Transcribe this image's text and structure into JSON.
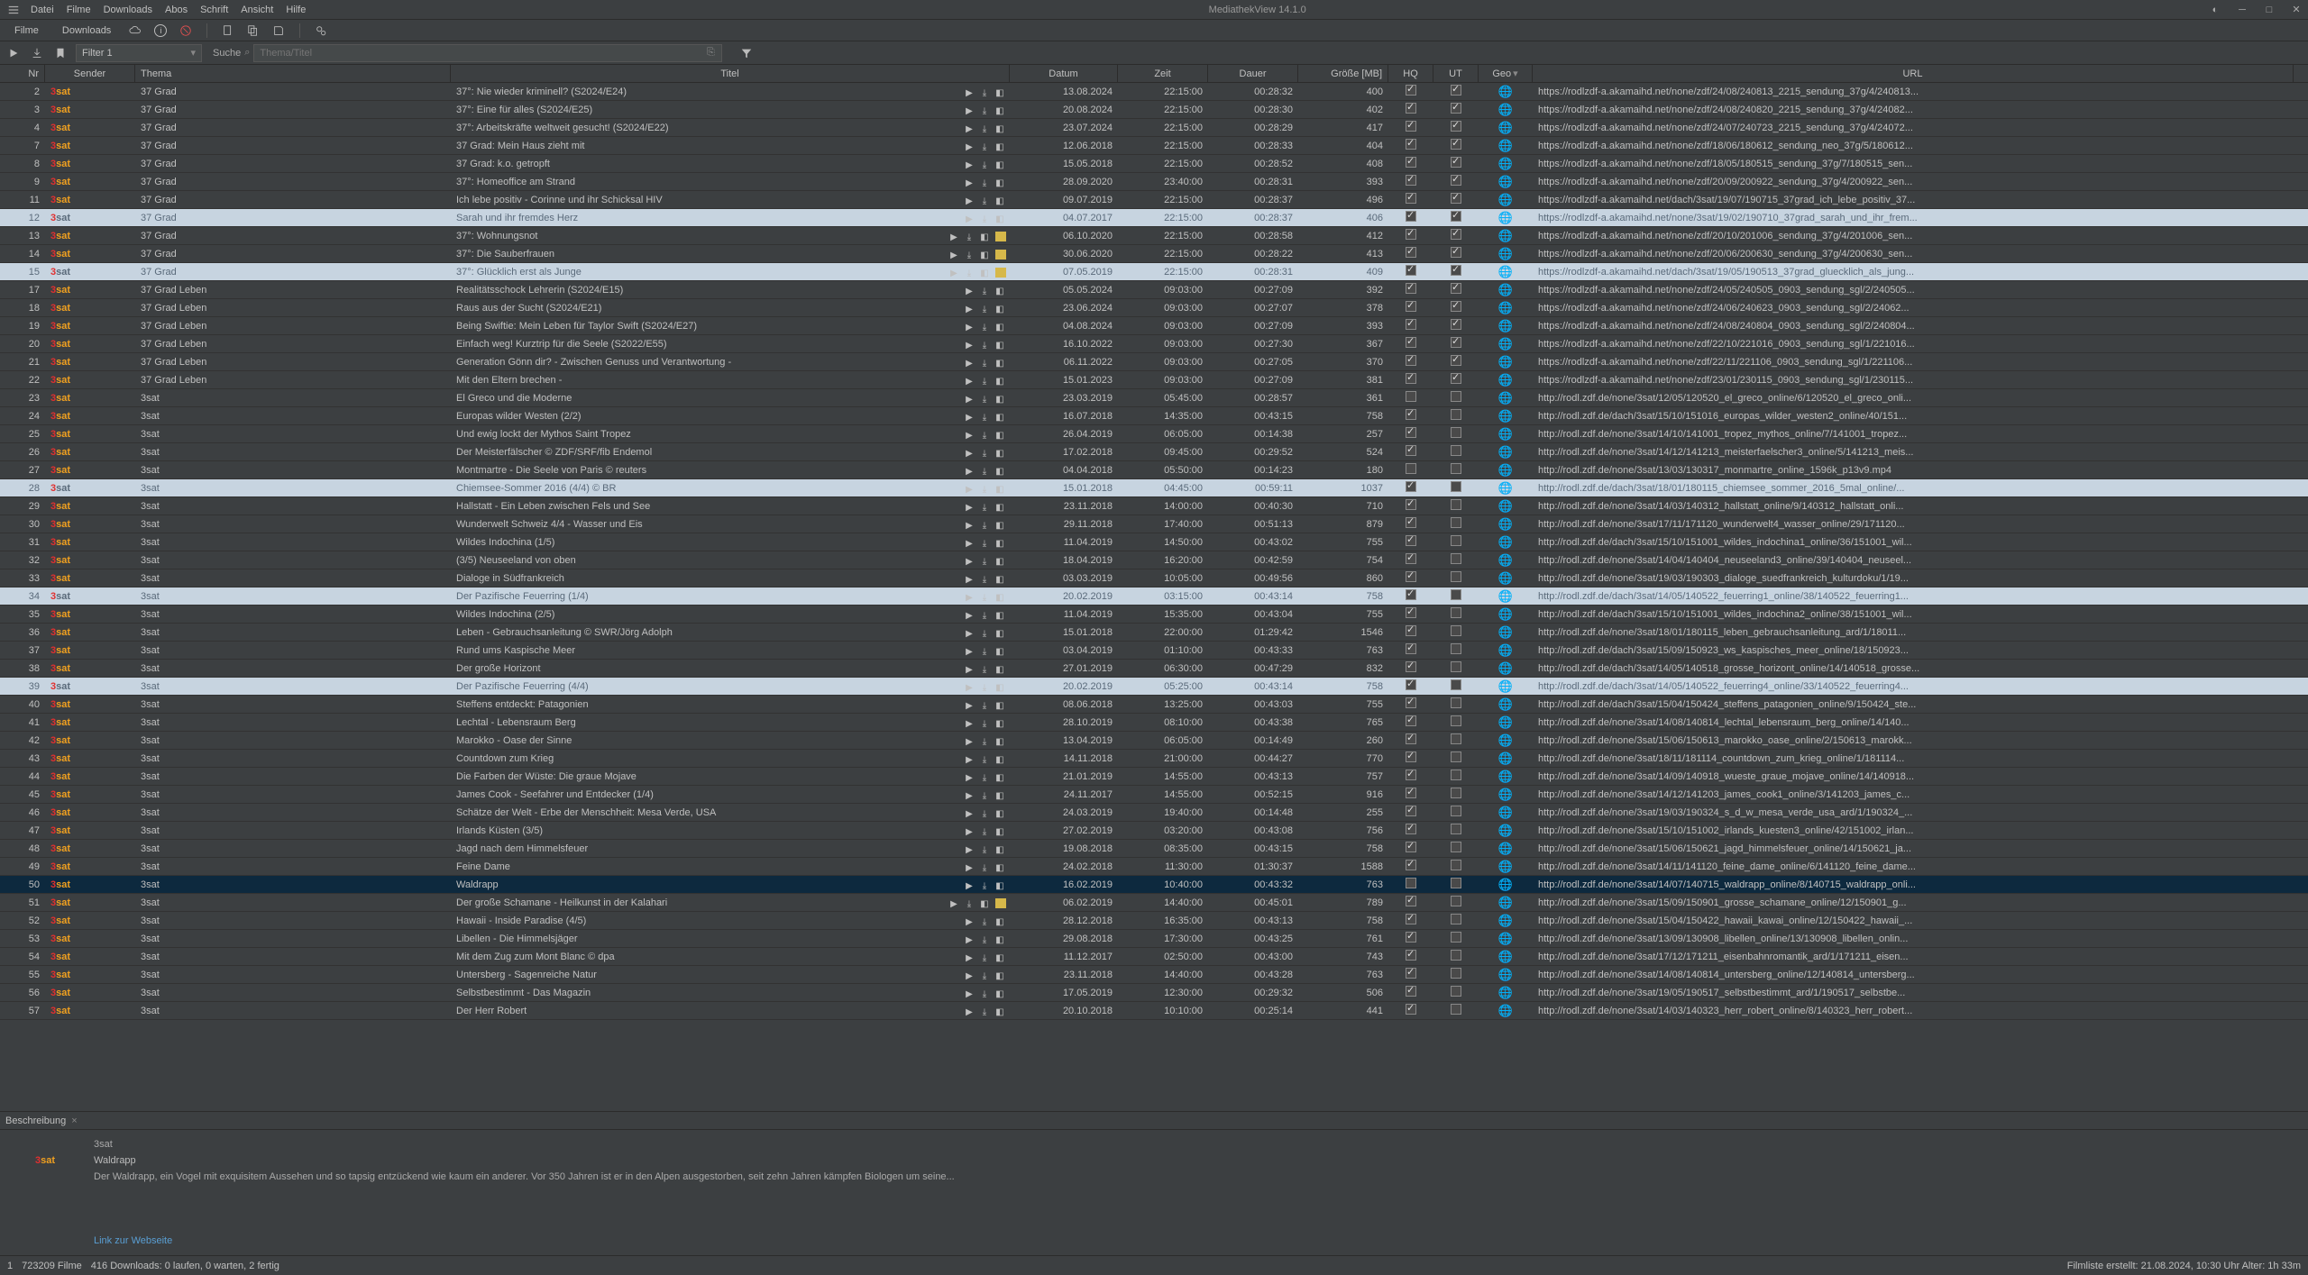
{
  "app": {
    "title": "MediathekView 14.1.0"
  },
  "menu": [
    "Datei",
    "Filme",
    "Downloads",
    "Abos",
    "Schrift",
    "Ansicht",
    "Hilfe"
  ],
  "tabs": {
    "films": "Filme",
    "downloads": "Downloads"
  },
  "filter": {
    "label": "Filter 1"
  },
  "search": {
    "label": "Suche",
    "placeholder": "Thema/Titel"
  },
  "columns": {
    "nr": "Nr",
    "sender": "Sender",
    "thema": "Thema",
    "titel": "Titel",
    "datum": "Datum",
    "zeit": "Zeit",
    "dauer": "Dauer",
    "size": "Größe [MB]",
    "hq": "HQ",
    "ut": "UT",
    "geo": "Geo",
    "url": "URL"
  },
  "rows": [
    {
      "nr": 2,
      "thema": "37 Grad",
      "titel": "37°: Nie wieder kriminell? (S2024/E24)",
      "datum": "13.08.2024",
      "zeit": "22:15:00",
      "dauer": "00:28:32",
      "size": 400,
      "hq": true,
      "ut": true,
      "url": "https://rodlzdf-a.akamaihd.net/none/zdf/24/08/240813_2215_sendung_37g/4/240813..."
    },
    {
      "nr": 3,
      "thema": "37 Grad",
      "titel": "37°: Eine für alles (S2024/E25)",
      "datum": "20.08.2024",
      "zeit": "22:15:00",
      "dauer": "00:28:30",
      "size": 402,
      "hq": true,
      "ut": true,
      "url": "https://rodlzdf-a.akamaihd.net/none/zdf/24/08/240820_2215_sendung_37g/4/24082..."
    },
    {
      "nr": 4,
      "thema": "37 Grad",
      "titel": "37°: Arbeitskräfte weltweit gesucht! (S2024/E22)",
      "datum": "23.07.2024",
      "zeit": "22:15:00",
      "dauer": "00:28:29",
      "size": 417,
      "hq": true,
      "ut": true,
      "url": "https://rodlzdf-a.akamaihd.net/none/zdf/24/07/240723_2215_sendung_37g/4/24072..."
    },
    {
      "nr": 7,
      "thema": "37 Grad",
      "titel": "37 Grad: Mein Haus zieht mit",
      "datum": "12.06.2018",
      "zeit": "22:15:00",
      "dauer": "00:28:33",
      "size": 404,
      "hq": true,
      "ut": true,
      "url": "https://rodlzdf-a.akamaihd.net/none/zdf/18/06/180612_sendung_neo_37g/5/180612..."
    },
    {
      "nr": 8,
      "thema": "37 Grad",
      "titel": "37 Grad: k.o. getropft",
      "datum": "15.05.2018",
      "zeit": "22:15:00",
      "dauer": "00:28:52",
      "size": 408,
      "hq": true,
      "ut": true,
      "url": "https://rodlzdf-a.akamaihd.net/none/zdf/18/05/180515_sendung_37g/7/180515_sen..."
    },
    {
      "nr": 9,
      "thema": "37 Grad",
      "titel": "37°: Homeoffice am Strand",
      "datum": "28.09.2020",
      "zeit": "23:40:00",
      "dauer": "00:28:31",
      "size": 393,
      "hq": true,
      "ut": true,
      "url": "https://rodlzdf-a.akamaihd.net/none/zdf/20/09/200922_sendung_37g/4/200922_sen..."
    },
    {
      "nr": 11,
      "thema": "37 Grad",
      "titel": "Ich lebe positiv - Corinne und ihr Schicksal HIV",
      "datum": "09.07.2019",
      "zeit": "22:15:00",
      "dauer": "00:28:37",
      "size": 496,
      "hq": true,
      "ut": true,
      "url": "https://rodlzdf-a.akamaihd.net/dach/3sat/19/07/190715_37grad_ich_lebe_positiv_37..."
    },
    {
      "nr": 12,
      "thema": "37 Grad",
      "titel": "Sarah und ihr fremdes Herz",
      "datum": "04.07.2017",
      "zeit": "22:15:00",
      "dauer": "00:28:37",
      "size": 406,
      "hq": true,
      "ut": true,
      "url": "https://rodlzdf-a.akamaihd.net/none/3sat/19/02/190710_37grad_sarah_und_ihr_frem...",
      "light": true
    },
    {
      "nr": 13,
      "thema": "37 Grad",
      "titel": "37°: Wohnungsnot",
      "datum": "06.10.2020",
      "zeit": "22:15:00",
      "dauer": "00:28:58",
      "size": 412,
      "hq": true,
      "ut": true,
      "url": "https://rodlzdf-a.akamaihd.net/none/zdf/20/10/201006_sendung_37g/4/201006_sen..."
    },
    {
      "nr": 14,
      "thema": "37 Grad",
      "titel": "37°: Die Sauberfrauen",
      "datum": "30.06.2020",
      "zeit": "22:15:00",
      "dauer": "00:28:22",
      "size": 413,
      "hq": true,
      "ut": true,
      "url": "https://rodlzdf-a.akamaihd.net/none/zdf/20/06/200630_sendung_37g/4/200630_sen..."
    },
    {
      "nr": 15,
      "thema": "37 Grad",
      "titel": "37°: Glücklich erst als Junge",
      "datum": "07.05.2019",
      "zeit": "22:15:00",
      "dauer": "00:28:31",
      "size": 409,
      "hq": true,
      "ut": true,
      "url": "https://rodlzdf-a.akamaihd.net/dach/3sat/19/05/190513_37grad_gluecklich_als_jung...",
      "light": true
    },
    {
      "nr": 17,
      "thema": "37 Grad Leben",
      "titel": "Realitätsschock Lehrerin (S2024/E15)",
      "datum": "05.05.2024",
      "zeit": "09:03:00",
      "dauer": "00:27:09",
      "size": 392,
      "hq": true,
      "ut": true,
      "url": "https://rodlzdf-a.akamaihd.net/none/zdf/24/05/240505_0903_sendung_sgl/2/240505..."
    },
    {
      "nr": 18,
      "thema": "37 Grad Leben",
      "titel": "Raus aus der Sucht (S2024/E21)",
      "datum": "23.06.2024",
      "zeit": "09:03:00",
      "dauer": "00:27:07",
      "size": 378,
      "hq": true,
      "ut": true,
      "url": "https://rodlzdf-a.akamaihd.net/none/zdf/24/06/240623_0903_sendung_sgl/2/24062..."
    },
    {
      "nr": 19,
      "thema": "37 Grad Leben",
      "titel": "Being Swiftie: Mein Leben für Taylor Swift (S2024/E27)",
      "datum": "04.08.2024",
      "zeit": "09:03:00",
      "dauer": "00:27:09",
      "size": 393,
      "hq": true,
      "ut": true,
      "url": "https://rodlzdf-a.akamaihd.net/none/zdf/24/08/240804_0903_sendung_sgl/2/240804..."
    },
    {
      "nr": 20,
      "thema": "37 Grad Leben",
      "titel": "Einfach weg! Kurztrip für die Seele (S2022/E55)",
      "datum": "16.10.2022",
      "zeit": "09:03:00",
      "dauer": "00:27:30",
      "size": 367,
      "hq": true,
      "ut": true,
      "url": "https://rodlzdf-a.akamaihd.net/none/zdf/22/10/221016_0903_sendung_sgl/1/221016..."
    },
    {
      "nr": 21,
      "thema": "37 Grad Leben",
      "titel": "Generation Gönn dir? - Zwischen Genuss und Verantwortung -",
      "datum": "06.11.2022",
      "zeit": "09:03:00",
      "dauer": "00:27:05",
      "size": 370,
      "hq": true,
      "ut": true,
      "url": "https://rodlzdf-a.akamaihd.net/none/zdf/22/11/221106_0903_sendung_sgl/1/221106..."
    },
    {
      "nr": 22,
      "thema": "37 Grad Leben",
      "titel": "Mit den Eltern brechen -",
      "datum": "15.01.2023",
      "zeit": "09:03:00",
      "dauer": "00:27:09",
      "size": 381,
      "hq": true,
      "ut": true,
      "url": "https://rodlzdf-a.akamaihd.net/none/zdf/23/01/230115_0903_sendung_sgl/1/230115..."
    },
    {
      "nr": 23,
      "thema": "3sat",
      "titel": "El Greco und die Moderne",
      "datum": "23.03.2019",
      "zeit": "05:45:00",
      "dauer": "00:28:57",
      "size": 361,
      "hq": false,
      "ut": false,
      "url": "http://rodl.zdf.de/none/3sat/12/05/120520_el_greco_online/6/120520_el_greco_onli..."
    },
    {
      "nr": 24,
      "thema": "3sat",
      "titel": "Europas wilder Westen (2/2)",
      "datum": "16.07.2018",
      "zeit": "14:35:00",
      "dauer": "00:43:15",
      "size": 758,
      "hq": true,
      "ut": false,
      "url": "http://rodl.zdf.de/dach/3sat/15/10/151016_europas_wilder_westen2_online/40/151..."
    },
    {
      "nr": 25,
      "thema": "3sat",
      "titel": "Und ewig lockt der Mythos Saint Tropez",
      "datum": "26.04.2019",
      "zeit": "06:05:00",
      "dauer": "00:14:38",
      "size": 257,
      "hq": true,
      "ut": false,
      "url": "http://rodl.zdf.de/none/3sat/14/10/141001_tropez_mythos_online/7/141001_tropez..."
    },
    {
      "nr": 26,
      "thema": "3sat",
      "titel": "Der Meisterfälscher © ZDF/SRF/fib Endemol",
      "datum": "17.02.2018",
      "zeit": "09:45:00",
      "dauer": "00:29:52",
      "size": 524,
      "hq": true,
      "ut": false,
      "url": "http://rodl.zdf.de/none/3sat/14/12/141213_meisterfaelscher3_online/5/141213_meis..."
    },
    {
      "nr": 27,
      "thema": "3sat",
      "titel": "Montmartre - Die Seele von Paris © reuters",
      "datum": "04.04.2018",
      "zeit": "05:50:00",
      "dauer": "00:14:23",
      "size": 180,
      "hq": false,
      "ut": false,
      "url": "http://rodl.zdf.de/none/3sat/13/03/130317_monmartre_online_1596k_p13v9.mp4"
    },
    {
      "nr": 28,
      "thema": "3sat",
      "titel": "Chiemsee-Sommer 2016 (4/4) © BR",
      "datum": "15.01.2018",
      "zeit": "04:45:00",
      "dauer": "00:59:11",
      "size": 1037,
      "hq": true,
      "ut": false,
      "url": "http://rodl.zdf.de/dach/3sat/18/01/180115_chiemsee_sommer_2016_5mal_online/...",
      "light": true
    },
    {
      "nr": 29,
      "thema": "3sat",
      "titel": "Hallstatt - Ein Leben zwischen Fels und See",
      "datum": "23.11.2018",
      "zeit": "14:00:00",
      "dauer": "00:40:30",
      "size": 710,
      "hq": true,
      "ut": false,
      "url": "http://rodl.zdf.de/none/3sat/14/03/140312_hallstatt_online/9/140312_hallstatt_onli..."
    },
    {
      "nr": 30,
      "thema": "3sat",
      "titel": "Wunderwelt Schweiz 4/4 - Wasser und Eis",
      "datum": "29.11.2018",
      "zeit": "17:40:00",
      "dauer": "00:51:13",
      "size": 879,
      "hq": true,
      "ut": false,
      "url": "http://rodl.zdf.de/none/3sat/17/11/171120_wunderwelt4_wasser_online/29/171120..."
    },
    {
      "nr": 31,
      "thema": "3sat",
      "titel": "Wildes Indochina (1/5)",
      "datum": "11.04.2019",
      "zeit": "14:50:00",
      "dauer": "00:43:02",
      "size": 755,
      "hq": true,
      "ut": false,
      "url": "http://rodl.zdf.de/dach/3sat/15/10/151001_wildes_indochina1_online/36/151001_wil..."
    },
    {
      "nr": 32,
      "thema": "3sat",
      "titel": "(3/5) Neuseeland von oben",
      "datum": "18.04.2019",
      "zeit": "16:20:00",
      "dauer": "00:42:59",
      "size": 754,
      "hq": true,
      "ut": false,
      "url": "http://rodl.zdf.de/none/3sat/14/04/140404_neuseeland3_online/39/140404_neuseel..."
    },
    {
      "nr": 33,
      "thema": "3sat",
      "titel": "Dialoge in Südfrankreich",
      "datum": "03.03.2019",
      "zeit": "10:05:00",
      "dauer": "00:49:56",
      "size": 860,
      "hq": true,
      "ut": false,
      "url": "http://rodl.zdf.de/none/3sat/19/03/190303_dialoge_suedfrankreich_kulturdoku/1/19..."
    },
    {
      "nr": 34,
      "thema": "3sat",
      "titel": "Der Pazifische Feuerring (1/4)",
      "datum": "20.02.2019",
      "zeit": "03:15:00",
      "dauer": "00:43:14",
      "size": 758,
      "hq": true,
      "ut": false,
      "url": "http://rodl.zdf.de/dach/3sat/14/05/140522_feuerring1_online/38/140522_feuerring1...",
      "light": true
    },
    {
      "nr": 35,
      "thema": "3sat",
      "titel": "Wildes Indochina (2/5)",
      "datum": "11.04.2019",
      "zeit": "15:35:00",
      "dauer": "00:43:04",
      "size": 755,
      "hq": true,
      "ut": false,
      "url": "http://rodl.zdf.de/dach/3sat/15/10/151001_wildes_indochina2_online/38/151001_wil..."
    },
    {
      "nr": 36,
      "thema": "3sat",
      "titel": "Leben - Gebrauchsanleitung © SWR/Jörg Adolph",
      "datum": "15.01.2018",
      "zeit": "22:00:00",
      "dauer": "01:29:42",
      "size": 1546,
      "hq": true,
      "ut": false,
      "url": "http://rodl.zdf.de/none/3sat/18/01/180115_leben_gebrauchsanleitung_ard/1/18011..."
    },
    {
      "nr": 37,
      "thema": "3sat",
      "titel": "Rund ums Kaspische Meer",
      "datum": "03.04.2019",
      "zeit": "01:10:00",
      "dauer": "00:43:33",
      "size": 763,
      "hq": true,
      "ut": false,
      "url": "http://rodl.zdf.de/dach/3sat/15/09/150923_ws_kaspisches_meer_online/18/150923..."
    },
    {
      "nr": 38,
      "thema": "3sat",
      "titel": "Der große Horizont",
      "datum": "27.01.2019",
      "zeit": "06:30:00",
      "dauer": "00:47:29",
      "size": 832,
      "hq": true,
      "ut": false,
      "url": "http://rodl.zdf.de/dach/3sat/14/05/140518_grosse_horizont_online/14/140518_grosse..."
    },
    {
      "nr": 39,
      "thema": "3sat",
      "titel": "Der Pazifische Feuerring (4/4)",
      "datum": "20.02.2019",
      "zeit": "05:25:00",
      "dauer": "00:43:14",
      "size": 758,
      "hq": true,
      "ut": false,
      "url": "http://rodl.zdf.de/dach/3sat/14/05/140522_feuerring4_online/33/140522_feuerring4...",
      "light": true
    },
    {
      "nr": 40,
      "thema": "3sat",
      "titel": "Steffens entdeckt: Patagonien",
      "datum": "08.06.2018",
      "zeit": "13:25:00",
      "dauer": "00:43:03",
      "size": 755,
      "hq": true,
      "ut": false,
      "url": "http://rodl.zdf.de/dach/3sat/15/04/150424_steffens_patagonien_online/9/150424_ste..."
    },
    {
      "nr": 41,
      "thema": "3sat",
      "titel": "Lechtal - Lebensraum Berg",
      "datum": "28.10.2019",
      "zeit": "08:10:00",
      "dauer": "00:43:38",
      "size": 765,
      "hq": true,
      "ut": false,
      "url": "http://rodl.zdf.de/none/3sat/14/08/140814_lechtal_lebensraum_berg_online/14/140..."
    },
    {
      "nr": 42,
      "thema": "3sat",
      "titel": "Marokko - Oase der Sinne",
      "datum": "13.04.2019",
      "zeit": "06:05:00",
      "dauer": "00:14:49",
      "size": 260,
      "hq": true,
      "ut": false,
      "url": "http://rodl.zdf.de/none/3sat/15/06/150613_marokko_oase_online/2/150613_marokk..."
    },
    {
      "nr": 43,
      "thema": "3sat",
      "titel": "Countdown zum Krieg",
      "datum": "14.11.2018",
      "zeit": "21:00:00",
      "dauer": "00:44:27",
      "size": 770,
      "hq": true,
      "ut": false,
      "url": "http://rodl.zdf.de/none/3sat/18/11/181114_countdown_zum_krieg_online/1/181114..."
    },
    {
      "nr": 44,
      "thema": "3sat",
      "titel": "Die Farben der Wüste: Die graue Mojave",
      "datum": "21.01.2019",
      "zeit": "14:55:00",
      "dauer": "00:43:13",
      "size": 757,
      "hq": true,
      "ut": false,
      "url": "http://rodl.zdf.de/none/3sat/14/09/140918_wueste_graue_mojave_online/14/140918..."
    },
    {
      "nr": 45,
      "thema": "3sat",
      "titel": "James Cook - Seefahrer und Entdecker (1/4)",
      "datum": "24.11.2017",
      "zeit": "14:55:00",
      "dauer": "00:52:15",
      "size": 916,
      "hq": true,
      "ut": false,
      "url": "http://rodl.zdf.de/none/3sat/14/12/141203_james_cook1_online/3/141203_james_c..."
    },
    {
      "nr": 46,
      "thema": "3sat",
      "titel": "Schätze der Welt - Erbe der Menschheit: Mesa Verde, USA",
      "datum": "24.03.2019",
      "zeit": "19:40:00",
      "dauer": "00:14:48",
      "size": 255,
      "hq": true,
      "ut": false,
      "url": "http://rodl.zdf.de/none/3sat/19/03/190324_s_d_w_mesa_verde_usa_ard/1/190324_..."
    },
    {
      "nr": 47,
      "thema": "3sat",
      "titel": "Irlands Küsten (3/5)",
      "datum": "27.02.2019",
      "zeit": "03:20:00",
      "dauer": "00:43:08",
      "size": 756,
      "hq": true,
      "ut": false,
      "url": "http://rodl.zdf.de/none/3sat/15/10/151002_irlands_kuesten3_online/42/151002_irlan..."
    },
    {
      "nr": 48,
      "thema": "3sat",
      "titel": "Jagd nach dem Himmelsfeuer",
      "datum": "19.08.2018",
      "zeit": "08:35:00",
      "dauer": "00:43:15",
      "size": 758,
      "hq": true,
      "ut": false,
      "url": "http://rodl.zdf.de/none/3sat/15/06/150621_jagd_himmelsfeuer_online/14/150621_ja..."
    },
    {
      "nr": 49,
      "thema": "3sat",
      "titel": "Feine Dame",
      "datum": "24.02.2018",
      "zeit": "11:30:00",
      "dauer": "01:30:37",
      "size": 1588,
      "hq": true,
      "ut": false,
      "url": "http://rodl.zdf.de/none/3sat/14/11/141120_feine_dame_online/6/141120_feine_dame..."
    },
    {
      "nr": 50,
      "thema": "3sat",
      "titel": "Waldrapp",
      "datum": "16.02.2019",
      "zeit": "10:40:00",
      "dauer": "00:43:32",
      "size": 763,
      "hq": false,
      "ut": false,
      "url": "http://rodl.zdf.de/none/3sat/14/07/140715_waldrapp_online/8/140715_waldrapp_onli...",
      "selected": true
    },
    {
      "nr": 51,
      "thema": "3sat",
      "titel": "Der große Schamane - Heilkunst in der Kalahari",
      "datum": "06.02.2019",
      "zeit": "14:40:00",
      "dauer": "00:45:01",
      "size": 789,
      "hq": true,
      "ut": false,
      "url": "http://rodl.zdf.de/none/3sat/15/09/150901_grosse_schamane_online/12/150901_g..."
    },
    {
      "nr": 52,
      "thema": "3sat",
      "titel": "Hawaii - Inside Paradise (4/5)",
      "datum": "28.12.2018",
      "zeit": "16:35:00",
      "dauer": "00:43:13",
      "size": 758,
      "hq": true,
      "ut": false,
      "url": "http://rodl.zdf.de/none/3sat/15/04/150422_hawaii_kawai_online/12/150422_hawaii_..."
    },
    {
      "nr": 53,
      "thema": "3sat",
      "titel": "Libellen - Die Himmelsjäger",
      "datum": "29.08.2018",
      "zeit": "17:30:00",
      "dauer": "00:43:25",
      "size": 761,
      "hq": true,
      "ut": false,
      "url": "http://rodl.zdf.de/none/3sat/13/09/130908_libellen_online/13/130908_libellen_onlin..."
    },
    {
      "nr": 54,
      "thema": "3sat",
      "titel": "Mit dem Zug zum Mont Blanc © dpa",
      "datum": "11.12.2017",
      "zeit": "02:50:00",
      "dauer": "00:43:00",
      "size": 743,
      "hq": true,
      "ut": false,
      "url": "http://rodl.zdf.de/none/3sat/17/12/171211_eisenbahnromantik_ard/1/171211_eisen..."
    },
    {
      "nr": 55,
      "thema": "3sat",
      "titel": "Untersberg - Sagenreiche Natur",
      "datum": "23.11.2018",
      "zeit": "14:40:00",
      "dauer": "00:43:28",
      "size": 763,
      "hq": true,
      "ut": false,
      "url": "http://rodl.zdf.de/none/3sat/14/08/140814_untersberg_online/12/140814_untersberg..."
    },
    {
      "nr": 56,
      "thema": "3sat",
      "titel": "Selbstbestimmt - Das Magazin",
      "datum": "17.05.2019",
      "zeit": "12:30:00",
      "dauer": "00:29:32",
      "size": 506,
      "hq": true,
      "ut": false,
      "url": "http://rodl.zdf.de/none/3sat/19/05/190517_selbstbestimmt_ard/1/190517_selbstbe..."
    },
    {
      "nr": 57,
      "thema": "3sat",
      "titel": "Der Herr Robert",
      "datum": "20.10.2018",
      "zeit": "10:10:00",
      "dauer": "00:25:14",
      "size": 441,
      "hq": true,
      "ut": false,
      "url": "http://rodl.zdf.de/none/3sat/14/03/140323_herr_robert_online/8/140323_herr_robert..."
    }
  ],
  "desc": {
    "tab": "Beschreibung",
    "channel": "3sat",
    "title": "Waldrapp",
    "text": "Der Waldrapp, ein Vogel mit exquisitem Aussehen und so tapsig entzückend wie kaum ein anderer. Vor 350 Jahren ist er in den Alpen ausgestorben, seit zehn Jahren kämpfen Biologen um seine...",
    "link": "Link zur Webseite"
  },
  "status": {
    "sel": "1",
    "films": "723209 Filme",
    "downloads": "416 Downloads: 0 laufen, 0 warten, 2 fertig",
    "right": "Filmliste erstellt: 21.08.2024, 10:30 Uhr   Alter: 1h 33m"
  }
}
